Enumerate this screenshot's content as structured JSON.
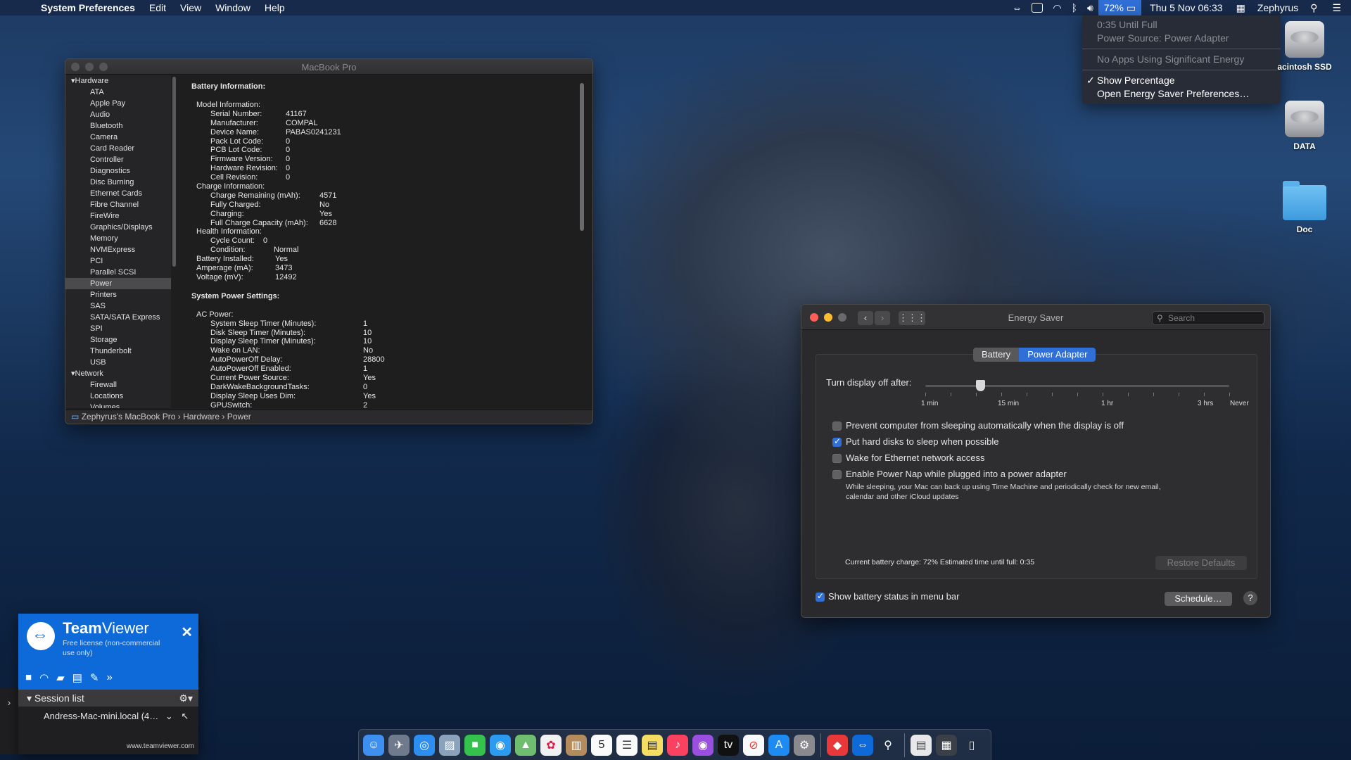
{
  "menubar": {
    "app_name": "System Preferences",
    "menus": [
      "Edit",
      "View",
      "Window",
      "Help"
    ],
    "battery_percent": "72%",
    "datetime": "Thu 5 Nov  06:33",
    "user": "Zephyrus"
  },
  "battery_menu": {
    "time_until_full": "0:35 Until Full",
    "power_source": "Power Source: Power Adapter",
    "no_apps": "No Apps Using Significant Energy",
    "show_percentage": "Show Percentage",
    "open_prefs": "Open Energy Saver Preferences…"
  },
  "desktop_icons": [
    {
      "label": "acintosh SSD",
      "icon": "internal-drive-icon"
    },
    {
      "label": "DATA",
      "icon": "internal-drive-icon"
    },
    {
      "label": "Doc",
      "icon": "folder-icon"
    }
  ],
  "sysinfo": {
    "title": "MacBook Pro",
    "sidebar": {
      "hardware_group": "Hardware",
      "hardware_items": [
        "ATA",
        "Apple Pay",
        "Audio",
        "Bluetooth",
        "Camera",
        "Card Reader",
        "Controller",
        "Diagnostics",
        "Disc Burning",
        "Ethernet Cards",
        "Fibre Channel",
        "FireWire",
        "Graphics/Displays",
        "Memory",
        "NVMExpress",
        "PCI",
        "Parallel SCSI",
        "Power",
        "Printers",
        "SAS",
        "SATA/SATA Express",
        "SPI",
        "Storage",
        "Thunderbolt",
        "USB"
      ],
      "selected": "Power",
      "network_group": "Network",
      "network_items": [
        "Firewall",
        "Locations",
        "Volumes"
      ]
    },
    "battery_info_heading": "Battery Information:",
    "model_info_label": "Model Information:",
    "model_info": [
      {
        "k": "Serial Number:",
        "v": "41167"
      },
      {
        "k": "Manufacturer:",
        "v": "COMPAL"
      },
      {
        "k": "Device Name:",
        "v": "PABAS0241231"
      },
      {
        "k": "Pack Lot Code:",
        "v": "0"
      },
      {
        "k": "PCB Lot Code:",
        "v": "0"
      },
      {
        "k": "Firmware Version:",
        "v": "0"
      },
      {
        "k": "Hardware Revision:",
        "v": "0"
      },
      {
        "k": "Cell Revision:",
        "v": "0"
      }
    ],
    "charge_info_label": "Charge Information:",
    "charge_info": [
      {
        "k": "Charge Remaining (mAh):",
        "v": "4571"
      },
      {
        "k": "Fully Charged:",
        "v": "No"
      },
      {
        "k": "Charging:",
        "v": "Yes"
      },
      {
        "k": "Full Charge Capacity (mAh):",
        "v": "6628"
      }
    ],
    "health_info_label": "Health Information:",
    "health_info": [
      {
        "k": "Cycle Count:",
        "v": "0"
      },
      {
        "k": "Condition:",
        "v": "Normal"
      }
    ],
    "battery_extra": [
      {
        "k": "Battery Installed:",
        "v": "Yes"
      },
      {
        "k": "Amperage (mA):",
        "v": "3473"
      },
      {
        "k": "Voltage (mV):",
        "v": "12492"
      }
    ],
    "power_settings_heading": "System Power Settings:",
    "ac_power_label": "AC Power:",
    "ac_power": [
      {
        "k": "System Sleep Timer (Minutes):",
        "v": "1"
      },
      {
        "k": "Disk Sleep Timer (Minutes):",
        "v": "10"
      },
      {
        "k": "Display Sleep Timer (Minutes):",
        "v": "10"
      },
      {
        "k": "Wake on LAN:",
        "v": "No"
      },
      {
        "k": "AutoPowerOff Delay:",
        "v": "28800"
      },
      {
        "k": "AutoPowerOff Enabled:",
        "v": "1"
      },
      {
        "k": "Current Power Source:",
        "v": "Yes"
      },
      {
        "k": "DarkWakeBackgroundTasks:",
        "v": "0"
      },
      {
        "k": "Display Sleep Uses Dim:",
        "v": "Yes"
      },
      {
        "k": "GPUSwitch:",
        "v": "2"
      }
    ],
    "path": [
      "Zephyrus's MacBook Pro",
      "Hardware",
      "Power"
    ]
  },
  "energy": {
    "title": "Energy Saver",
    "search_placeholder": "Search",
    "tab_battery": "Battery",
    "tab_power_adapter": "Power Adapter",
    "display_off_label": "Turn display off after:",
    "display_off_fraction": 0.18,
    "ticks": [
      "1 min",
      "15 min",
      "1 hr",
      "3 hrs",
      "Never"
    ],
    "options": [
      {
        "label": "Prevent computer from sleeping automatically when the display is off",
        "checked": false
      },
      {
        "label": "Put hard disks to sleep when possible",
        "checked": true
      },
      {
        "label": "Wake for Ethernet network access",
        "checked": false
      },
      {
        "label": "Enable Power Nap while plugged into a power adapter",
        "checked": false
      }
    ],
    "power_nap_desc_1": "While sleeping, your Mac can back up using Time Machine and periodically check for new email,",
    "power_nap_desc_2": "calendar and other iCloud updates",
    "battery_status": "Current battery charge: 72% Estimated time until full: 0:35",
    "restore_defaults": "Restore Defaults",
    "show_battery_status": "Show battery status in menu bar",
    "show_battery_checked": true,
    "schedule": "Schedule…",
    "help": "?"
  },
  "teamviewer": {
    "brand_bold": "Team",
    "brand_rest": "Viewer",
    "license": "Free license (non-commercial use only)",
    "session_list": "Session list",
    "session_item": "Andress-Mac-mini.local (4…",
    "footer": "www.teamviewer.com"
  },
  "colors": {
    "accent": "#2f6fd6",
    "teamviewer_blue": "#0e6ad8",
    "close_red": "#fe5f57",
    "minimize_yellow": "#febc2e",
    "zoom_green": "#28c840"
  }
}
